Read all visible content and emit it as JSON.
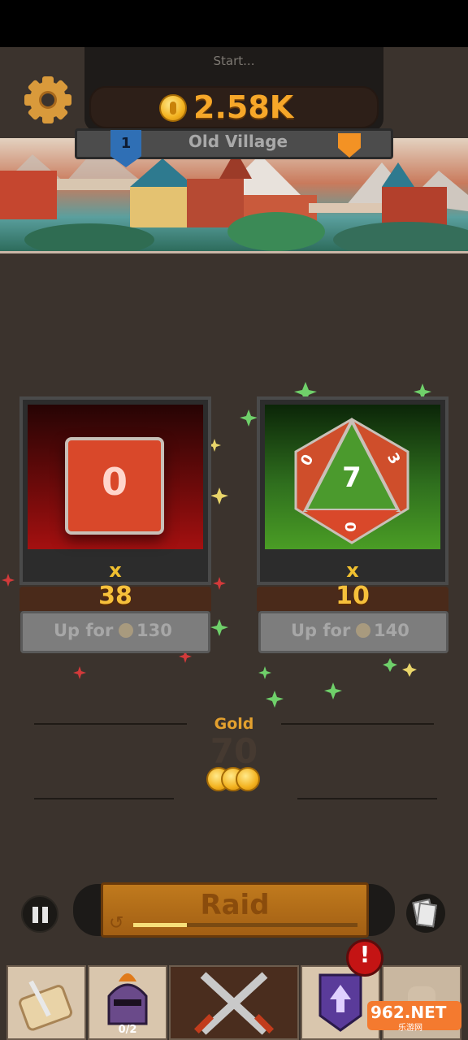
{
  "header": {
    "loading_text": "Start...",
    "gold_total": "2.58K",
    "settings_icon": "gear-icon"
  },
  "location": {
    "level": "1",
    "name": "Old Village",
    "shield_icon": "shield-icon"
  },
  "dice": [
    {
      "id": "red-die",
      "face": "0",
      "multiplier_symbol": "x",
      "count": "38",
      "upgrade_label": "Up for",
      "upgrade_cost": "130",
      "color": "#d9482a"
    },
    {
      "id": "green-die",
      "face": "7",
      "side_faces": [
        "0",
        "3",
        "0"
      ],
      "multiplier_symbol": "x",
      "count": "10",
      "upgrade_label": "Up for",
      "upgrade_cost": "140",
      "color": "#4b9a2d"
    }
  ],
  "reward": {
    "label": "Gold",
    "amount": "70"
  },
  "controls": {
    "raid_label": "Raid",
    "raid_progress": 0.24,
    "pause_icon": "pause-icon",
    "refresh_icon": "refresh-icon",
    "cards_icon": "cards-icon"
  },
  "bottom_nav": {
    "tabs": [
      {
        "name": "quest-scroll",
        "icon": "scroll-quill-icon"
      },
      {
        "name": "heroes",
        "icon": "knight-helmet-icon",
        "count": "0/2"
      },
      {
        "name": "battle",
        "icon": "crossed-swords-icon"
      },
      {
        "name": "upgrades",
        "icon": "upgrade-arrow-banner-icon"
      },
      {
        "name": "locked",
        "icon": "locked-icon"
      }
    ],
    "alert_text": "!"
  },
  "watermark": {
    "main": "962.NET",
    "sub": "乐游网"
  },
  "colors": {
    "background": "#3b332d",
    "gold": "#f6a729",
    "card_red": "#a41010",
    "card_green": "#4a9d25",
    "raid_orange": "#c07a1d",
    "alert_red": "#c41414"
  }
}
